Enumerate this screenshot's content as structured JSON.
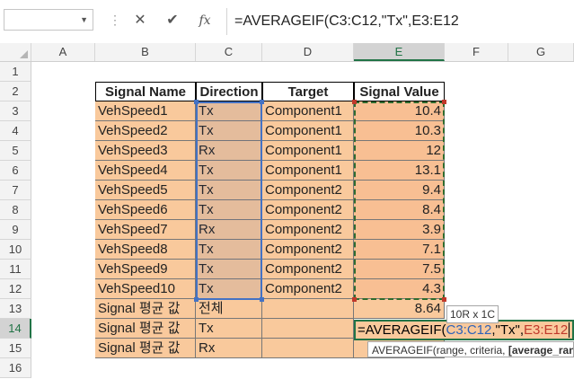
{
  "formula_bar": {
    "cancel_icon": "x-icon",
    "enter_icon": "check-icon",
    "fx_label": "fx",
    "formula": "=AVERAGEIF(C3:C12,\"Tx\",E3:E12"
  },
  "columns": [
    "A",
    "B",
    "C",
    "D",
    "E",
    "F",
    "G"
  ],
  "rows": [
    "1",
    "2",
    "3",
    "4",
    "5",
    "6",
    "7",
    "8",
    "9",
    "10",
    "11",
    "12",
    "13",
    "14",
    "15",
    "16"
  ],
  "table": {
    "headers": [
      "Signal Name",
      "Direction",
      "Target",
      "Signal Value"
    ],
    "data": [
      [
        "VehSpeed1",
        "Tx",
        "Component1",
        "10.4"
      ],
      [
        "VehSpeed2",
        "Tx",
        "Component1",
        "10.3"
      ],
      [
        "VehSpeed3",
        "Rx",
        "Component1",
        "12"
      ],
      [
        "VehSpeed4",
        "Tx",
        "Component1",
        "13.1"
      ],
      [
        "VehSpeed5",
        "Tx",
        "Component2",
        "9.4"
      ],
      [
        "VehSpeed6",
        "Tx",
        "Component2",
        "8.4"
      ],
      [
        "VehSpeed7",
        "Rx",
        "Component2",
        "3.9"
      ],
      [
        "VehSpeed8",
        "Tx",
        "Component2",
        "7.1"
      ],
      [
        "VehSpeed9",
        "Tx",
        "Component2",
        "7.5"
      ],
      [
        "VehSpeed10",
        "Tx",
        "Component2",
        "4.3"
      ]
    ],
    "summary": [
      [
        "Signal 평균 값",
        "전체",
        "",
        "8.64"
      ],
      [
        "Signal 평균 값",
        "Tx",
        "",
        ""
      ],
      [
        "Signal 평균 값",
        "Rx",
        "",
        ""
      ]
    ]
  },
  "editing": {
    "part1": "=AVERAGEIF(",
    "part2": "C3:C12",
    "part3": ",\"Tx\",",
    "part4": "E3:E12"
  },
  "size_tooltip": "10R x 1C",
  "function_tooltip": {
    "text": "AVERAGEIF(range, criteria, ",
    "bold": "[average_rang"
  },
  "colors": {
    "accent": "#217346",
    "range_blue": "#4472c4",
    "cell_fill": "#f9c99c"
  }
}
